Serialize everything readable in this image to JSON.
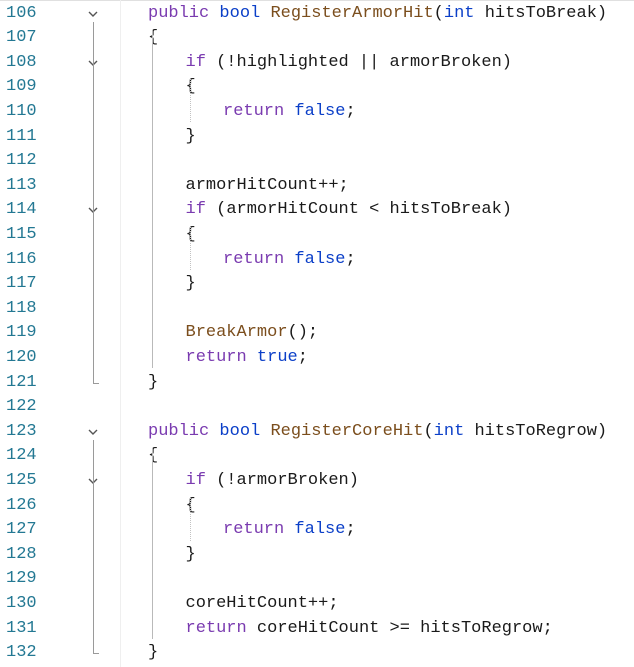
{
  "editor": {
    "colors": {
      "background": "#ffffff",
      "line_number": "#237893",
      "keyword": "#7a3bb0",
      "type": "#0b3fc8",
      "function": "#7b4e1d",
      "text": "#1a1a1a"
    },
    "icons": {
      "fold": "chevron-down-icon"
    },
    "lines": [
      {
        "num": "106",
        "indent": 0,
        "fold": true,
        "tokens": [
          {
            "t": "kw",
            "v": "public"
          },
          {
            "t": "sym",
            "v": " "
          },
          {
            "t": "type",
            "v": "bool"
          },
          {
            "t": "sym",
            "v": " "
          },
          {
            "t": "fn",
            "v": "RegisterArmorHit"
          },
          {
            "t": "sym",
            "v": "("
          },
          {
            "t": "type",
            "v": "int"
          },
          {
            "t": "sym",
            "v": " "
          },
          {
            "t": "id",
            "v": "hitsToBreak"
          },
          {
            "t": "sym",
            "v": ")"
          }
        ]
      },
      {
        "num": "107",
        "indent": 0,
        "fold": false,
        "tokens": [
          {
            "t": "sym",
            "v": "{"
          }
        ]
      },
      {
        "num": "108",
        "indent": 1,
        "fold": true,
        "tokens": [
          {
            "t": "kw",
            "v": "if"
          },
          {
            "t": "sym",
            "v": " (!"
          },
          {
            "t": "id",
            "v": "highlighted"
          },
          {
            "t": "sym",
            "v": " || "
          },
          {
            "t": "id",
            "v": "armorBroken"
          },
          {
            "t": "sym",
            "v": ")"
          }
        ]
      },
      {
        "num": "109",
        "indent": 1,
        "fold": false,
        "tokens": [
          {
            "t": "sym",
            "v": "{"
          }
        ]
      },
      {
        "num": "110",
        "indent": 2,
        "fold": false,
        "tokens": [
          {
            "t": "kw",
            "v": "return"
          },
          {
            "t": "sym",
            "v": " "
          },
          {
            "t": "type",
            "v": "false"
          },
          {
            "t": "sym",
            "v": ";"
          }
        ]
      },
      {
        "num": "111",
        "indent": 1,
        "fold": false,
        "tokens": [
          {
            "t": "sym",
            "v": "}"
          }
        ]
      },
      {
        "num": "112",
        "indent": 0,
        "fold": false,
        "tokens": []
      },
      {
        "num": "113",
        "indent": 1,
        "fold": false,
        "tokens": [
          {
            "t": "id",
            "v": "armorHitCount"
          },
          {
            "t": "sym",
            "v": "++;"
          }
        ]
      },
      {
        "num": "114",
        "indent": 1,
        "fold": true,
        "tokens": [
          {
            "t": "kw",
            "v": "if"
          },
          {
            "t": "sym",
            "v": " ("
          },
          {
            "t": "id",
            "v": "armorHitCount"
          },
          {
            "t": "sym",
            "v": " < "
          },
          {
            "t": "id",
            "v": "hitsToBreak"
          },
          {
            "t": "sym",
            "v": ")"
          }
        ]
      },
      {
        "num": "115",
        "indent": 1,
        "fold": false,
        "tokens": [
          {
            "t": "sym",
            "v": "{"
          }
        ]
      },
      {
        "num": "116",
        "indent": 2,
        "fold": false,
        "tokens": [
          {
            "t": "kw",
            "v": "return"
          },
          {
            "t": "sym",
            "v": " "
          },
          {
            "t": "type",
            "v": "false"
          },
          {
            "t": "sym",
            "v": ";"
          }
        ]
      },
      {
        "num": "117",
        "indent": 1,
        "fold": false,
        "tokens": [
          {
            "t": "sym",
            "v": "}"
          }
        ]
      },
      {
        "num": "118",
        "indent": 0,
        "fold": false,
        "tokens": []
      },
      {
        "num": "119",
        "indent": 1,
        "fold": false,
        "tokens": [
          {
            "t": "fn",
            "v": "BreakArmor"
          },
          {
            "t": "sym",
            "v": "();"
          }
        ]
      },
      {
        "num": "120",
        "indent": 1,
        "fold": false,
        "tokens": [
          {
            "t": "kw",
            "v": "return"
          },
          {
            "t": "sym",
            "v": " "
          },
          {
            "t": "type",
            "v": "true"
          },
          {
            "t": "sym",
            "v": ";"
          }
        ]
      },
      {
        "num": "121",
        "indent": 0,
        "fold": false,
        "tokens": [
          {
            "t": "sym",
            "v": "}"
          }
        ]
      },
      {
        "num": "122",
        "indent": 0,
        "fold": false,
        "tokens": []
      },
      {
        "num": "123",
        "indent": 0,
        "fold": true,
        "tokens": [
          {
            "t": "kw",
            "v": "public"
          },
          {
            "t": "sym",
            "v": " "
          },
          {
            "t": "type",
            "v": "bool"
          },
          {
            "t": "sym",
            "v": " "
          },
          {
            "t": "fn",
            "v": "RegisterCoreHit"
          },
          {
            "t": "sym",
            "v": "("
          },
          {
            "t": "type",
            "v": "int"
          },
          {
            "t": "sym",
            "v": " "
          },
          {
            "t": "id",
            "v": "hitsToRegrow"
          },
          {
            "t": "sym",
            "v": ")"
          }
        ]
      },
      {
        "num": "124",
        "indent": 0,
        "fold": false,
        "tokens": [
          {
            "t": "sym",
            "v": "{"
          }
        ]
      },
      {
        "num": "125",
        "indent": 1,
        "fold": true,
        "tokens": [
          {
            "t": "kw",
            "v": "if"
          },
          {
            "t": "sym",
            "v": " (!"
          },
          {
            "t": "id",
            "v": "armorBroken"
          },
          {
            "t": "sym",
            "v": ")"
          }
        ]
      },
      {
        "num": "126",
        "indent": 1,
        "fold": false,
        "tokens": [
          {
            "t": "sym",
            "v": "{"
          }
        ]
      },
      {
        "num": "127",
        "indent": 2,
        "fold": false,
        "tokens": [
          {
            "t": "kw",
            "v": "return"
          },
          {
            "t": "sym",
            "v": " "
          },
          {
            "t": "type",
            "v": "false"
          },
          {
            "t": "sym",
            "v": ";"
          }
        ]
      },
      {
        "num": "128",
        "indent": 1,
        "fold": false,
        "tokens": [
          {
            "t": "sym",
            "v": "}"
          }
        ]
      },
      {
        "num": "129",
        "indent": 0,
        "fold": false,
        "tokens": []
      },
      {
        "num": "130",
        "indent": 1,
        "fold": false,
        "tokens": [
          {
            "t": "id",
            "v": "coreHitCount"
          },
          {
            "t": "sym",
            "v": "++;"
          }
        ]
      },
      {
        "num": "131",
        "indent": 1,
        "fold": false,
        "tokens": [
          {
            "t": "kw",
            "v": "return"
          },
          {
            "t": "sym",
            "v": " "
          },
          {
            "t": "id",
            "v": "coreHitCount"
          },
          {
            "t": "sym",
            "v": " >= "
          },
          {
            "t": "id",
            "v": "hitsToRegrow"
          },
          {
            "t": "sym",
            "v": ";"
          }
        ]
      },
      {
        "num": "132",
        "indent": 0,
        "fold": false,
        "tokens": [
          {
            "t": "sym",
            "v": "}"
          }
        ]
      }
    ]
  }
}
